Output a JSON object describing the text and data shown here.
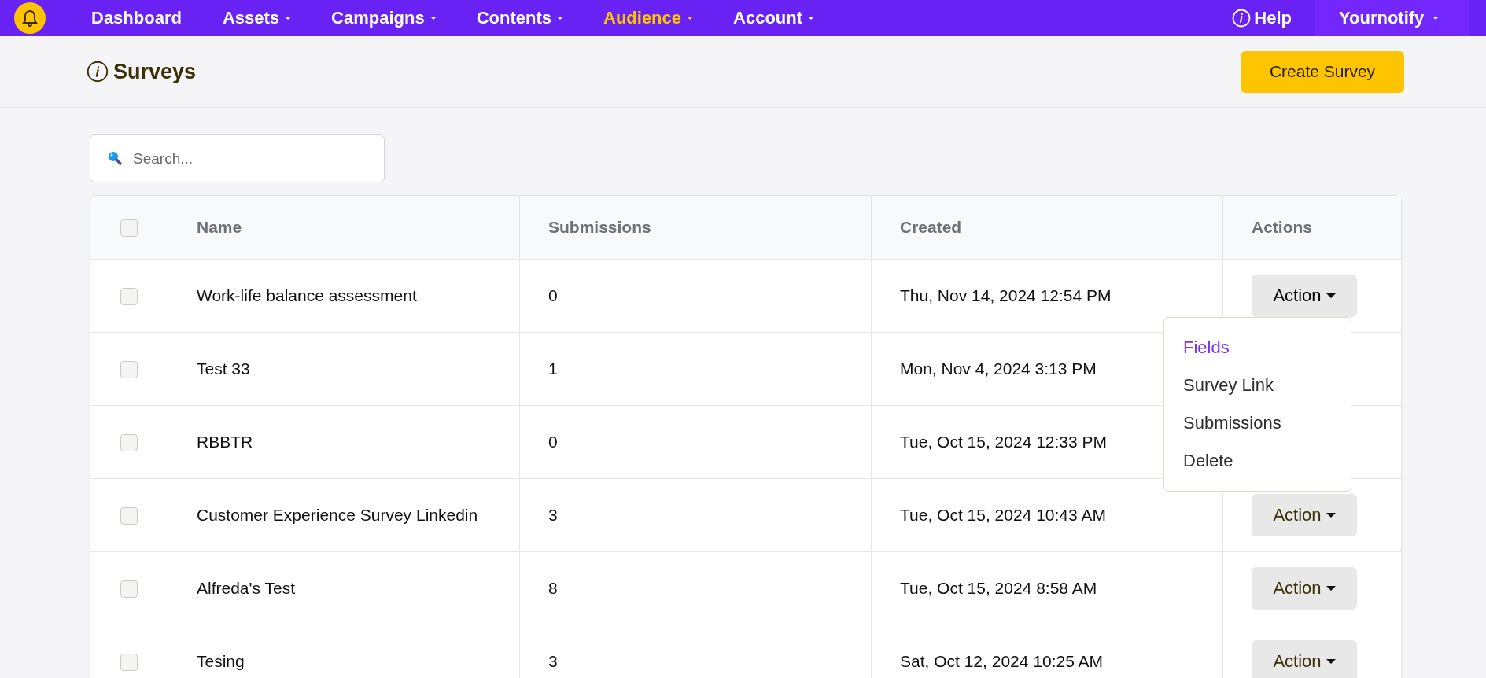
{
  "nav": {
    "items": [
      {
        "label": "Dashboard",
        "has_menu": false,
        "selected": false
      },
      {
        "label": "Assets",
        "has_menu": true,
        "selected": false
      },
      {
        "label": "Campaigns",
        "has_menu": true,
        "selected": false
      },
      {
        "label": "Contents",
        "has_menu": true,
        "selected": false
      },
      {
        "label": "Audience",
        "has_menu": true,
        "selected": true
      },
      {
        "label": "Account",
        "has_menu": true,
        "selected": false
      }
    ],
    "help": "Help",
    "account": "Yournotify"
  },
  "page": {
    "title": "Surveys",
    "create_button": "Create Survey"
  },
  "search": {
    "placeholder": "Search..."
  },
  "table": {
    "select_all_checked": false,
    "columns": [
      "Name",
      "Submissions",
      "Created",
      "Actions"
    ],
    "rows": [
      {
        "checked": false,
        "name": "Work-life balance assessment",
        "submissions": "0",
        "created": "Thu, Nov 14, 2024 12:54 PM",
        "action": "Action",
        "expanded": true
      },
      {
        "checked": false,
        "name": "Test 33",
        "submissions": "1",
        "created": "Mon, Nov 4, 2024 3:13 PM"
      },
      {
        "checked": false,
        "name": "RBBTR",
        "submissions": "0",
        "created": "Tue, Oct 15, 2024 12:33 PM"
      },
      {
        "checked": false,
        "name": "Customer Experience Survey Linkedin",
        "submissions": "3",
        "created": "Tue, Oct 15, 2024 10:43 AM",
        "action": "Action",
        "expanded": false
      },
      {
        "checked": false,
        "name": "Alfreda's Test",
        "submissions": "8",
        "created": "Tue, Oct 15, 2024 8:58 AM",
        "action": "Action",
        "expanded": false
      },
      {
        "checked": false,
        "name": "Tesing",
        "submissions": "3",
        "created": "Sat, Oct 12, 2024 10:25 AM",
        "action": "Action",
        "expanded": false
      }
    ]
  },
  "action_menu": {
    "items": [
      {
        "label": "Fields",
        "selected": true
      },
      {
        "label": "Survey Link",
        "selected": false
      },
      {
        "label": "Submissions",
        "selected": false
      },
      {
        "label": "Delete",
        "selected": false
      }
    ]
  }
}
